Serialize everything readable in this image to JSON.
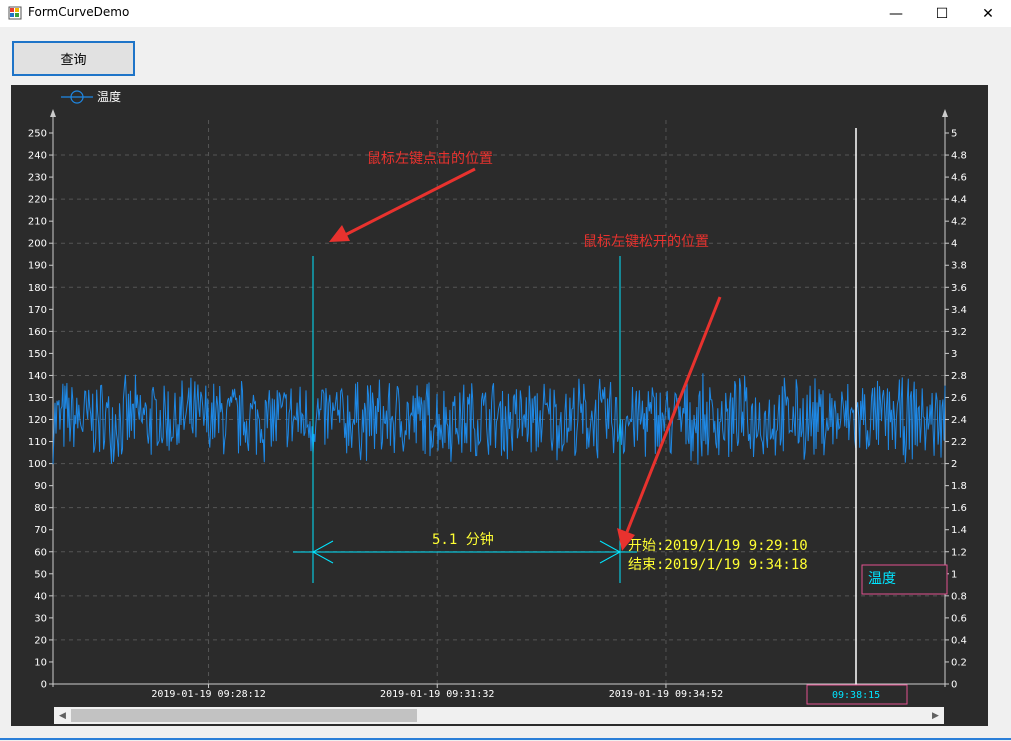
{
  "window": {
    "title": "FormCurveDemo",
    "minimize": "—",
    "maximize": "☐",
    "close": "✕"
  },
  "toolbar": {
    "query_label": "查询"
  },
  "annotations": {
    "press": "鼠标左键点击的位置",
    "release": "鼠标左键松开的位置",
    "duration": "5.1 分钟",
    "start": "开始:2019/1/19 9:29:10",
    "end": "结束:2019/1/19 9:34:18"
  },
  "cursor": {
    "label": "温度",
    "time": "09:38:15"
  },
  "colors": {
    "series": "#1e88e5",
    "background": "#2b2b2b",
    "cursor": "#00e5ff",
    "annotation": "#e8322e",
    "measure_text": "#ffff33"
  },
  "chart_data": {
    "type": "line",
    "legend": {
      "entries": [
        "温度"
      ],
      "position": "top-left"
    },
    "series": [
      {
        "name": "温度",
        "mean": 120,
        "min": 97,
        "max": 141
      }
    ],
    "y_left": {
      "min": 0,
      "max": 250,
      "step": 10,
      "ticks": [
        "0",
        "10",
        "20",
        "30",
        "40",
        "50",
        "60",
        "70",
        "80",
        "90",
        "100",
        "110",
        "120",
        "130",
        "140",
        "150",
        "160",
        "170",
        "180",
        "190",
        "200",
        "210",
        "220",
        "230",
        "240",
        "250"
      ]
    },
    "y_right": {
      "min": 0,
      "max": 5,
      "step": 0.2,
      "ticks": [
        "0",
        "0.2",
        "0.4",
        "0.6",
        "0.8",
        "1",
        "1.2",
        "1.4",
        "1.6",
        "1.8",
        "2",
        "2.2",
        "2.4",
        "2.6",
        "2.8",
        "3",
        "3.2",
        "3.4",
        "3.6",
        "3.8",
        "4",
        "4.2",
        "4.4",
        "4.6",
        "4.8",
        "5"
      ]
    },
    "x_ticks": [
      "2019-01-19 09:28:12",
      "2019-01-19 09:31:32",
      "2019-01-19 09:34:52"
    ],
    "x_range": [
      "2019-01-19 09:25:56",
      "2019-01-19 09:38:56"
    ],
    "markers": {
      "start": "2019-01-19 09:29:10",
      "end": "2019-01-19 09:34:18",
      "cursor": "2019-01-19 09:38:15"
    },
    "grid": true
  }
}
